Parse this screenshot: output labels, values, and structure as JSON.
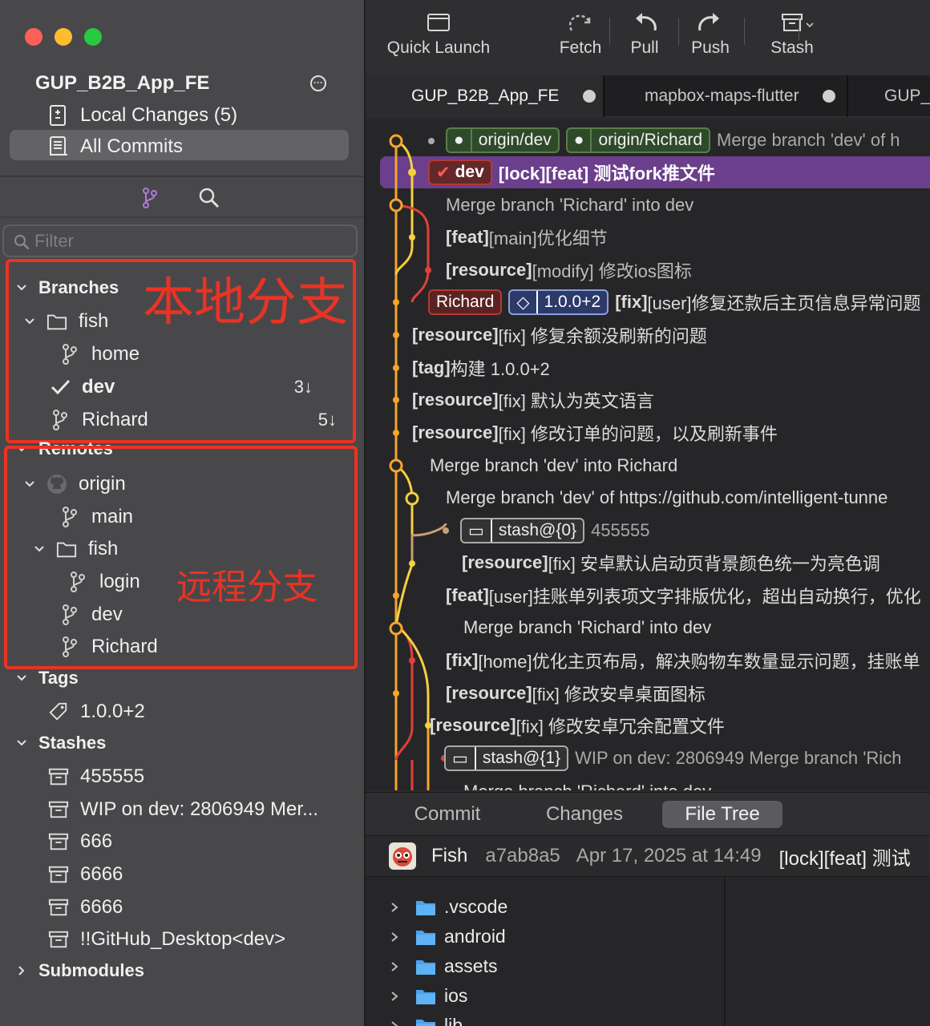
{
  "sidebar": {
    "repo_title": "GUP_B2B_App_FE",
    "workspace": [
      {
        "label": "Local Changes (5)"
      },
      {
        "label": "All Commits"
      }
    ],
    "filter_placeholder": "Filter",
    "branches_header": "Branches",
    "branches": [
      {
        "label": "fish"
      },
      {
        "label": "home"
      },
      {
        "label": "dev",
        "badge": "3↓"
      },
      {
        "label": "Richard",
        "badge": "5↓"
      }
    ],
    "remotes_header": "Remotes",
    "remotes": [
      {
        "label": "origin"
      },
      {
        "label": "main"
      },
      {
        "label": "fish"
      },
      {
        "label": "login"
      },
      {
        "label": "dev"
      },
      {
        "label": "Richard"
      }
    ],
    "tags_header": "Tags",
    "tags": [
      {
        "label": "1.0.0+2"
      }
    ],
    "stashes_header": "Stashes",
    "stashes": [
      {
        "label": "455555"
      },
      {
        "label": "WIP on dev: 2806949 Mer..."
      },
      {
        "label": "666"
      },
      {
        "label": "6666"
      },
      {
        "label": "6666"
      },
      {
        "label": "!!GitHub_Desktop<dev>"
      }
    ],
    "submodules_header": "Submodules",
    "annotations": {
      "local": "本地分支",
      "remote": "远程分支"
    }
  },
  "toolbar": {
    "quick_launch": "Quick Launch",
    "fetch": "Fetch",
    "pull": "Pull",
    "push": "Push",
    "stash": "Stash"
  },
  "tabs": [
    {
      "label": "GUP_B2B_App_FE"
    },
    {
      "label": "mapbox-maps-flutter"
    },
    {
      "label": "GUP_E"
    }
  ],
  "graph": {
    "rows": [
      {
        "refs": [
          "origin/dev",
          "origin/Richard"
        ],
        "msg": "Merge branch 'dev' of h"
      },
      {
        "ref_head": "dev",
        "msg_bold": "[lock][feat] 测试fork推文件"
      },
      {
        "msg": "Merge branch 'Richard' into dev"
      },
      {
        "msg_b": "[feat]",
        "msg": "[main]优化细节"
      },
      {
        "msg_b": "[resource]",
        "msg": "[modify] 修改ios图标"
      },
      {
        "ref_branch": "Richard",
        "ref_tag": "1.0.0+2",
        "msg_b": "[fix]",
        "msg": "[user]修复还款后主页信息异常问题"
      },
      {
        "msg_b": "[resource]",
        "msg": "[fix] 修复余额没刷新的问题"
      },
      {
        "msg_b": "[tag]",
        "msg": " 构建 1.0.0+2"
      },
      {
        "msg_b": "[resource]",
        "msg": "[fix] 默认为英文语言"
      },
      {
        "msg_b": "[resource]",
        "msg": "[fix] 修改订单的问题，以及刷新事件"
      },
      {
        "msg": "Merge branch 'dev' into Richard"
      },
      {
        "msg": "Merge branch 'dev' of https://github.com/intelligent-tunne"
      },
      {
        "ref_stash": "stash@{0}",
        "hash": "455555"
      },
      {
        "msg_b": "[resource]",
        "msg": "[fix] 安卓默认启动页背景颜色统一为亮色调"
      },
      {
        "msg_b": "[feat]",
        "msg": "[user]挂账单列表项文字排版优化，超出自动换行，优化"
      },
      {
        "msg": "Merge branch 'Richard' into dev"
      },
      {
        "msg_b": "[fix]",
        "msg": "[home]优化主页布局，解决购物车数量显示问题，挂账单"
      },
      {
        "msg_b": "[resource]",
        "msg": "[fix] 修改安卓桌面图标"
      },
      {
        "msg_b": "[resource]",
        "msg": "[fix] 修改安卓冗余配置文件"
      },
      {
        "ref_stash": "stash@{1}",
        "hash": "WIP on dev: 2806949 Merge branch 'Rich"
      },
      {
        "msg": "Merge branch 'Richard' into dev"
      }
    ]
  },
  "bottom": {
    "segments": [
      "Commit",
      "Changes",
      "File Tree"
    ],
    "author": "Fish",
    "hash": "a7ab8a5",
    "date": "Apr 17, 2025 at 14:49",
    "subject": "[lock][feat] 测试",
    "files": [
      ".vscode",
      "android",
      "assets",
      "ios",
      "lib"
    ]
  },
  "colors": {
    "selection_purple": "#6b3f8c",
    "graph_orange": "#f4a62a",
    "graph_red": "#e0413a",
    "graph_yellow": "#f5d040",
    "annotation_red": "#ea3323"
  }
}
